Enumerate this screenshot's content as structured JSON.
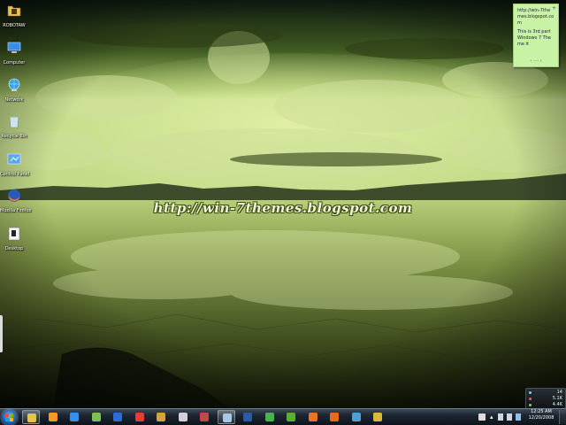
{
  "desktop": {
    "watermark": "http://win-7themes.blogspot.com",
    "icons": [
      {
        "label": "ROBOTAW",
        "icon": "folder-icon"
      },
      {
        "label": "Computer",
        "icon": "computer-icon"
      },
      {
        "label": "Network",
        "icon": "network-icon"
      },
      {
        "label": "Recycle Bin",
        "icon": "recycle-bin-icon"
      },
      {
        "label": "Control Panel",
        "icon": "control-panel-icon"
      },
      {
        "label": "Mozilla Firefox",
        "icon": "firefox-icon"
      },
      {
        "label": "Desktop",
        "icon": "desktop-shortcut-icon"
      }
    ]
  },
  "sticky_note": {
    "lines": [
      "http://win-7themes.blogspot.com",
      "This is 3rd part Windows 7 Theme it"
    ],
    "nav": "‹  ····  ›",
    "add": "+"
  },
  "gadget": {
    "rows": [
      {
        "value": "14",
        "color": "#6fd0ff"
      },
      {
        "value": "5.1K",
        "color": "#ff5a4a"
      },
      {
        "value": "4.4K",
        "color": "#6fdc5a"
      }
    ]
  },
  "taskbar": {
    "buttons": [
      {
        "name": "explorer",
        "color": "#e8c24a",
        "active": true
      },
      {
        "name": "media-player",
        "color": "#f39a2a",
        "active": false
      },
      {
        "name": "internet-explorer",
        "color": "#3a8ee8",
        "active": false
      },
      {
        "name": "network-tool",
        "color": "#7fbf5a",
        "active": false
      },
      {
        "name": "messenger",
        "color": "#2c6fd0",
        "active": false
      },
      {
        "name": "flashget",
        "color": "#e04030",
        "active": false
      },
      {
        "name": "tool",
        "color": "#d8a040",
        "active": false
      },
      {
        "name": "app",
        "color": "#d0d0d8",
        "active": false
      },
      {
        "name": "app2",
        "color": "#c04a4a",
        "active": false
      },
      {
        "name": "window",
        "color": "#a8c8e8",
        "active": true
      },
      {
        "name": "photoshop",
        "color": "#2a5aa8",
        "active": false
      },
      {
        "name": "chrome",
        "color": "#4ab050",
        "active": false
      },
      {
        "name": "utorrent",
        "color": "#5ab02a",
        "active": false
      },
      {
        "name": "firefox",
        "color": "#e8742a",
        "active": false
      },
      {
        "name": "office",
        "color": "#e86a1a",
        "active": false
      },
      {
        "name": "monitor",
        "color": "#4aa0d8",
        "active": false
      },
      {
        "name": "pen-tool",
        "color": "#d8b840",
        "active": false
      }
    ],
    "clock_time": "12:25 AM",
    "clock_date": "12/20/2008"
  }
}
